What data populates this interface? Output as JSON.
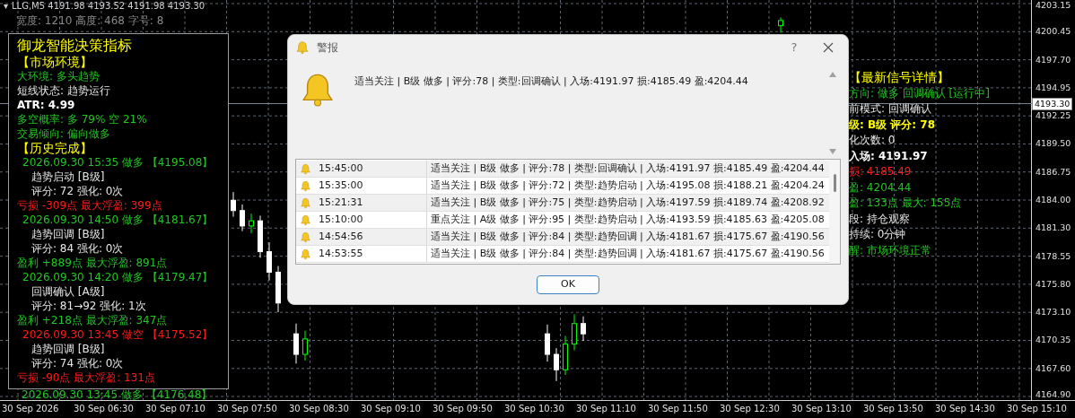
{
  "chart_header": {
    "menu_glyph": "▾",
    "symbol": "LLG,M5  4191.98 4193.52 4191.98 4193.30",
    "info": "宽度: 1210  高度: 468  字号: 8"
  },
  "left_panel": {
    "title": "御龙智能决策指标",
    "lines": [
      {
        "text": "【市场环境】",
        "kind": "section"
      },
      {
        "text": "大环境: 多头趋势",
        "kind": "up"
      },
      {
        "text": "短线状态: 趋势运行",
        "kind": "plain"
      },
      {
        "text": "ATR: 4.99",
        "kind": "strong"
      },
      {
        "text": "多空概率: 多 79%  空 21%",
        "kind": "up"
      },
      {
        "text": "交易倾向: 偏向做多",
        "kind": "up"
      },
      {
        "text": "【历史完成】",
        "kind": "section"
      },
      {
        "text": "2026.09.30 15:35 做多 【4195.08】",
        "kind": "uphead"
      },
      {
        "text": "趋势启动 [B级]",
        "kind": "sub"
      },
      {
        "text": "评分: 72  强化: 0次",
        "kind": "sub"
      },
      {
        "text": "亏损 -309点  最大浮盈: 399点",
        "kind": "down"
      },
      {
        "text": "2026.09.30 14:50 做多 【4181.67】",
        "kind": "uphead"
      },
      {
        "text": "趋势回调 [B级]",
        "kind": "sub"
      },
      {
        "text": "评分: 84  强化: 0次",
        "kind": "sub"
      },
      {
        "text": "盈利 +889点  最大浮盈: 891点",
        "kind": "up"
      },
      {
        "text": "2026.09.30 14:20 做多 【4179.47】",
        "kind": "uphead"
      },
      {
        "text": "回调确认 [A级]",
        "kind": "sub"
      },
      {
        "text": "评分: 81→92  强化: 1次",
        "kind": "sub"
      },
      {
        "text": "盈利 +218点  最大浮盈: 347点",
        "kind": "up"
      },
      {
        "text": "2026.09.30 13:45 做空 【4175.52】",
        "kind": "downhead"
      },
      {
        "text": "趋势回调 [B级]",
        "kind": "sub"
      },
      {
        "text": "评分: 74  强化: 0次",
        "kind": "sub"
      },
      {
        "text": "亏损 -90点  最大浮盈: 131点",
        "kind": "down"
      }
    ],
    "overflow_line": {
      "text": "2026.09.30 13:45 做多 【4176.48】",
      "kind": "uphead"
    }
  },
  "right_panel": {
    "lines": [
      {
        "text": "【最新信号详情】",
        "kind": "section"
      },
      {
        "text": "方向: 做多 回调确认 [运行中]",
        "kind": "up"
      },
      {
        "text": "前模式: 回调确认",
        "kind": "plain"
      },
      {
        "text": "级: B级  评分: 78",
        "kind": "gold"
      },
      {
        "text": "化次数: 0",
        "kind": "plain"
      },
      {
        "text": "入场: 4191.97",
        "kind": "strong"
      },
      {
        "text": "损: 4185.49",
        "kind": "down"
      },
      {
        "text": "盈: 4204.44",
        "kind": "up"
      },
      {
        "text": "盈: 133点  最大: 155点",
        "kind": "up"
      },
      {
        "text": "段: 持仓观察",
        "kind": "plain"
      },
      {
        "text": "持续: 0分钟",
        "kind": "plain"
      },
      {
        "text": "醒: 市场环境正常",
        "kind": "up"
      }
    ]
  },
  "price_axis": {
    "labels": [
      "4203.15",
      "4200.45",
      "4197.70",
      "4194.95",
      "4192.25",
      "4189.50",
      "4186.75",
      "4184.00",
      "4181.30",
      "4178.55",
      "4175.80",
      "4173.10",
      "4170.35",
      "4167.60",
      "4164.90"
    ],
    "current": "4193.30"
  },
  "time_axis": [
    "30 Sep 2026",
    "30 Sep 06:30",
    "30 Sep 07:10",
    "30 Sep 07:50",
    "30 Sep 08:30",
    "30 Sep 09:10",
    "30 Sep 09:50",
    "30 Sep 10:30",
    "30 Sep 11:10",
    "30 Sep 11:50",
    "30 Sep 12:30",
    "30 Sep 13:10",
    "30 Sep 13:50",
    "30 Sep 14:30",
    "30 Sep 15:10"
  ],
  "alert_dialog": {
    "title": "警报",
    "help": "?",
    "message": "适当关注 | B级 做多 | 评分:78 | 类型:回调确认 | 入场:4191.97 损:4185.49 盈:4204.44",
    "rows": [
      {
        "time": "15:45:00",
        "text": "适当关注 | B级 做多 | 评分:78 | 类型:回调确认 | 入场:4191.97 损:4185.49 盈:4204.44"
      },
      {
        "time": "15:35:00",
        "text": "适当关注 | B级 做多 | 评分:72 | 类型:趋势启动 | 入场:4195.08 损:4188.21 盈:4204.24"
      },
      {
        "time": "15:21:31",
        "text": "适当关注 | B级 做多 | 评分:75 | 类型:趋势启动 | 入场:4197.59 损:4189.74 盈:4208.92"
      },
      {
        "time": "15:10:00",
        "text": "重点关注 | A级 做多 | 评分:95 | 类型:趋势启动 | 入场:4193.59 损:4185.63 盈:4205.08"
      },
      {
        "time": "14:54:56",
        "text": "适当关注 | B级 做多 | 评分:84 | 类型:趋势回调 | 入场:4181.67 损:4175.67 盈:4190.56"
      },
      {
        "time": "14:53:55",
        "text": "适当关注 | B级 做多 | 评分:84 | 类型:趋势回调 | 入场:4181.67 损:4175.67 盈:4190.56"
      }
    ],
    "ok": "OK"
  }
}
